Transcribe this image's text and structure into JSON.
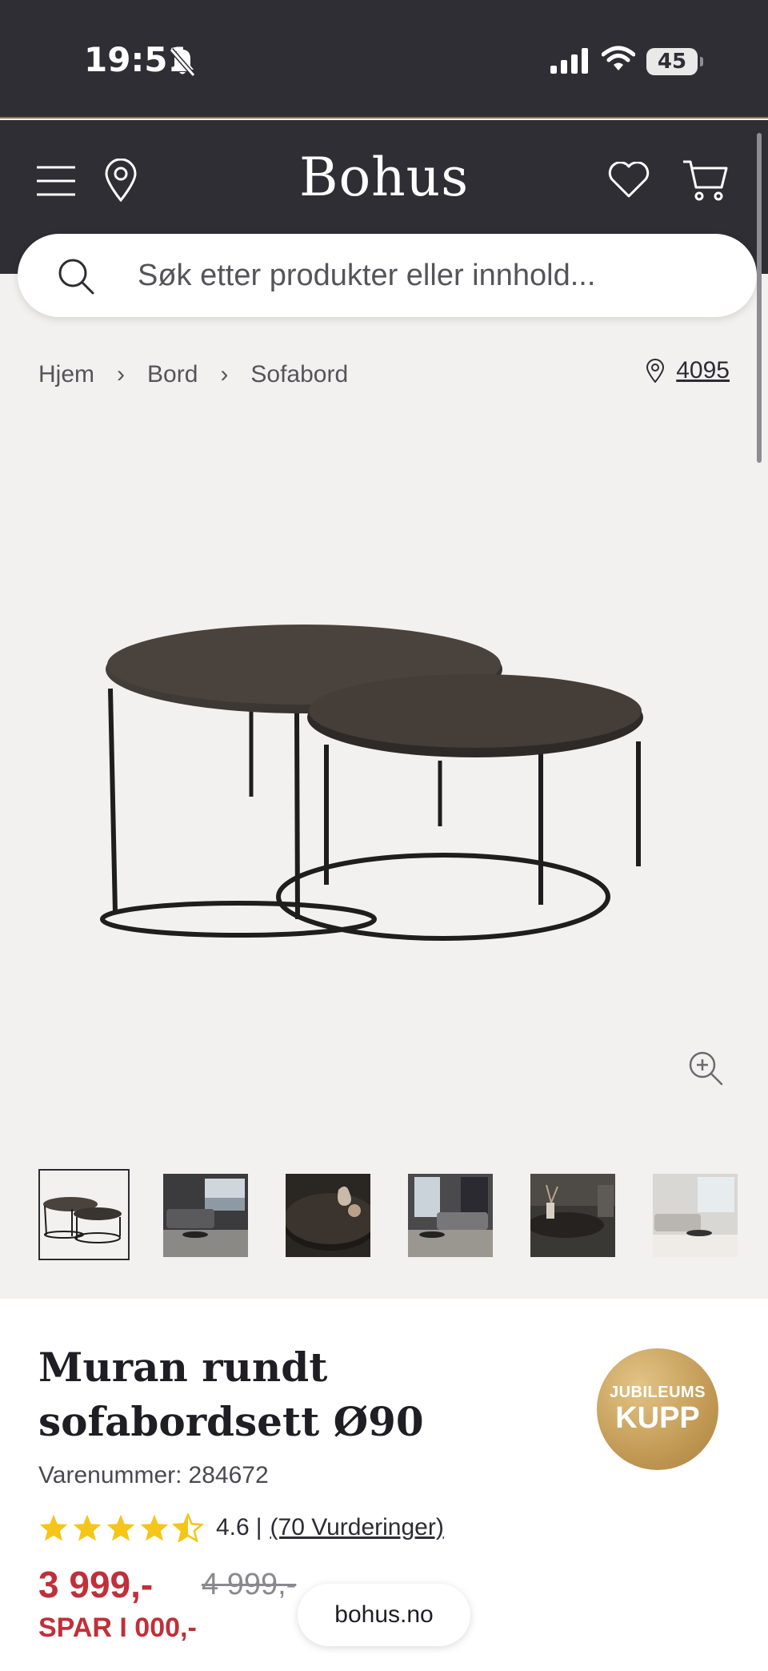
{
  "status_bar": {
    "time": "19:51",
    "battery": "45"
  },
  "header": {
    "logo": "Bohus"
  },
  "search": {
    "placeholder": "Søk etter produkter eller innhold..."
  },
  "breadcrumb": {
    "items": [
      "Hjem",
      "Bord",
      "Sofabord"
    ],
    "separator": "›"
  },
  "store": {
    "number": "4095"
  },
  "product": {
    "title_line1": "Muran rundt",
    "title_line2": "sofabordsett Ø90",
    "sku_label": "Varenummer:",
    "sku_value": "284672",
    "badge_top": "JUBILEUMS",
    "badge_bottom": "KUPP",
    "rating_value": "4.6",
    "rating_separator": "|",
    "rating_count": "(70 Vurderinger)",
    "rating_stars": 4.6,
    "price": "3 999,-",
    "old_price": "4 999,-",
    "savings": "SPAR I 000,-"
  },
  "thumbnails": [
    "table-set",
    "living-room-1",
    "table-closeup",
    "living-room-2",
    "table-styled",
    "living-room-3"
  ],
  "domain_pill": "bohus.no",
  "colors": {
    "header_bg": "#2f2e35",
    "page_bg": "#f3f1ef",
    "price_red": "#c0303a",
    "star_yellow": "#f5c518",
    "badge_gold": "#c29a55"
  }
}
